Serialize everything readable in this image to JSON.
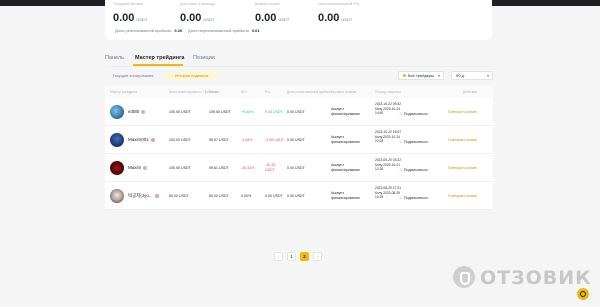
{
  "summary": {
    "balance_label": "Текущий баланс",
    "balance_value": "0.00",
    "available_label": "Доступно к выводу",
    "available_value": "0.00",
    "margin_label": "Маржа копий",
    "margin_value": "0.00",
    "unrealized_label": "Нереализованный PnL",
    "unrealized_value": "0.00",
    "unit": "USDT",
    "realized_pnl_label": "Доля реализованной прибыли",
    "realized_pnl_value": "9.26",
    "unrealized_share_label": "Доля нереализованной прибыли",
    "unrealized_share_value": "0.61"
  },
  "tabs": [
    {
      "label": "Панель"
    },
    {
      "label": "Мастер трейдинга"
    },
    {
      "label": "Позиции"
    }
  ],
  "filters": {
    "current_label": "Текущие копирования",
    "history_label": "История подписок",
    "traders_select": "Все трейдеры",
    "period_select": "90 д."
  },
  "table": {
    "headers": [
      "Мастер трейдинга",
      "Всего инвестировано / Прибыль",
      "Баланс",
      "ROI",
      "PnL",
      "Доля реализованной прибыли",
      "Причина отписки",
      "Период подписки",
      "",
      "Действие"
    ],
    "follow_label": "Подписаться",
    "action_label": "Повторить копию",
    "rows": [
      {
        "name": "e3t80",
        "invested": "100.00 USDT",
        "balance": "109.50 USDT",
        "roi": "+9.44%",
        "roi_sign": "pos",
        "pnl": "9.43 USDT",
        "pnl_sign": "pos",
        "realized_share": "0.00 USDT",
        "reason_line1": "Аккаунт",
        "reason_line2": "финансирования",
        "start": "2023-10-22 09:42",
        "end_prefix": "Кону",
        "end_date": "2023-10-24",
        "end_time": "14:40"
      },
      {
        "name": "Maxim001",
        "invested": "100.00 USDT",
        "balance": "96.97 USDT",
        "roi": "-3.08%",
        "roi_sign": "neg",
        "pnl": "-3.08 USDT",
        "pnl_sign": "neg",
        "realized_share": "0.00 USDT",
        "reason_line1": "Аккаунт",
        "reason_line2": "финансирования",
        "start": "2023-10-22 16:57",
        "end_prefix": "Кону",
        "end_date": "2023-10-24",
        "end_time": "22:03"
      },
      {
        "name": "Maxim",
        "invested": "100.00 USDT",
        "balance": "59.61 USDT",
        "roi": "-30.33%",
        "roi_sign": "neg",
        "pnl_line1": "-30.33",
        "pnl_line2": "USDT",
        "pnl_sign": "neg",
        "realized_share": "0.00 USDT",
        "reason_line1": "Аккаунт",
        "reason_line2": "финансирования",
        "start": "2023-09-20 03:22",
        "end_prefix": "Кону",
        "end_date": "2023-10-01",
        "end_time": "12:34"
      },
      {
        "name": "박공지(Jyo...",
        "invested": "50.00 USDT",
        "balance": "50.00 USDT",
        "roi": "0.00%",
        "roi_sign": "neutral",
        "pnl": "0.00 USDT",
        "pnl_sign": "neutral",
        "realized_share": "0.00 USDT",
        "reason_line1": "Аккаунт",
        "reason_line2": "финансирования",
        "start": "2023-08-20 17:31",
        "end_prefix": "Кону",
        "end_date": "2023-08-29",
        "end_time": "10:25"
      }
    ]
  },
  "pagination": {
    "prev": "‹",
    "pages": [
      "1",
      "2"
    ],
    "current": "2",
    "next": "›"
  },
  "watermark": {
    "text": "ОТЗОВИК"
  },
  "colors": {
    "accent": "#f0b90b",
    "positive": "#0ecb81",
    "negative": "#f6465d",
    "link": "#c99400"
  },
  "icons": {
    "follow": "star-outline-icon",
    "badge": "badge-icon",
    "help": "headset-icon",
    "dropdown": "chevron-down-icon"
  }
}
